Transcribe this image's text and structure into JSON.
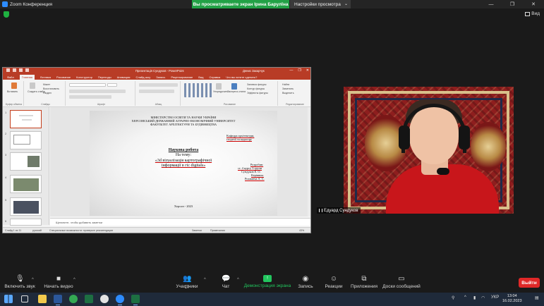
{
  "zoom": {
    "window_title": "Zoom Конференция",
    "share_banner": "Вы просматриваете экран Ірина Барулїна",
    "view_options": "Настройки просмотра",
    "view_button": "Вид",
    "window_controls": [
      "—",
      "❐",
      "✕"
    ]
  },
  "powerpoint": {
    "title": "Презентація Сундуков - PowerPoint",
    "user": "Денис Захарчук",
    "tabs": [
      "Файл",
      "Главная",
      "Вставка",
      "Рисование",
      "Конструктор",
      "Переходы",
      "Анимация",
      "Слайд-шоу",
      "Запись",
      "Рецензирование",
      "Вид",
      "Справка",
      "Что вы хотите сделать?"
    ],
    "active_tab": "Главная",
    "ribbon": {
      "paste": "Вставить",
      "clipboard": "Буфер обмена",
      "new_slide": "Создать слайд",
      "reuse": "Повторно использовать слайды",
      "layout": "Макет",
      "reset": "Восстановить",
      "section": "Раздел",
      "slides": "Слайды",
      "font": "Шрифт",
      "paragraph": "Абзац",
      "arrange": "Упорядочить",
      "quick_styles": "Экспресс-стили",
      "drawing": "Рисование",
      "shape_fill": "Заливка фигуры",
      "shape_outline": "Контур фигуры",
      "shape_effects": "Эффекты фигуры",
      "find": "Найти",
      "replace": "Заменить",
      "select": "Выделить",
      "editing": "Редактирование"
    },
    "thumb_numbers": [
      "1",
      "2",
      "3",
      "4",
      "5",
      "6"
    ],
    "slide": {
      "header1": "МІНІСТЕРСТВО ОСВІТИ ТА НАУКИ УКРАЇНИ",
      "header2": "ХЕРСОНСЬКИЙ ДЕРЖАВНИЙ АГРАРНО-ЕКОНОМІЧНИЙ УНІВЕРСИТЕТ",
      "header3": "ФАКУЛЬТЕТ АРХІТЕКТУРИ ТА БУДІВНИЦТВА",
      "dept1": "Кафедра архітектури,",
      "dept2": "геодезії та кадастру",
      "work": "Наукова робота",
      "topic": "На тему:",
      "title1": "«3d візуалізація картографічної",
      "title2": "інформації в гіс digitals»",
      "author_label": "Розробив:",
      "author_group": "ст. 4 курсу 3 групи",
      "author_name": "Сундуков Е. О.",
      "supervisor_label": "Керівник:",
      "supervisor_name": "Рохманча А. С.",
      "footer": "Херсон - 2023"
    },
    "notes_placeholder": "Щелкните, чтобы добавить заметки",
    "status": {
      "slide_counter": "Слайд 1 из 11",
      "language": "русский",
      "accessibility": "Специальные возможности: проверьте рекомендации",
      "notes": "Заметки",
      "comments": "Примечания",
      "zoom": "43%"
    }
  },
  "video": {
    "participant_name": "Едуард Сундуков"
  },
  "toolbar": {
    "mute": "Включить звук",
    "start_video": "Начать видео",
    "participants": "Участники",
    "participants_count": "17",
    "chat": "Чат",
    "share": "Демонстрация экрана",
    "record": "Запись",
    "reactions": "Реакции",
    "apps": "Приложения",
    "whiteboards": "Доски сообщений",
    "leave": "Выйти"
  },
  "taskbar": {
    "language": "УКР",
    "time": "13:04",
    "date": "16.02.2023"
  },
  "colors": {
    "zoom_green": "#22a146",
    "ppt_red": "#b83c26",
    "leave_red": "#e02828",
    "shirt_red": "#c8161b"
  }
}
